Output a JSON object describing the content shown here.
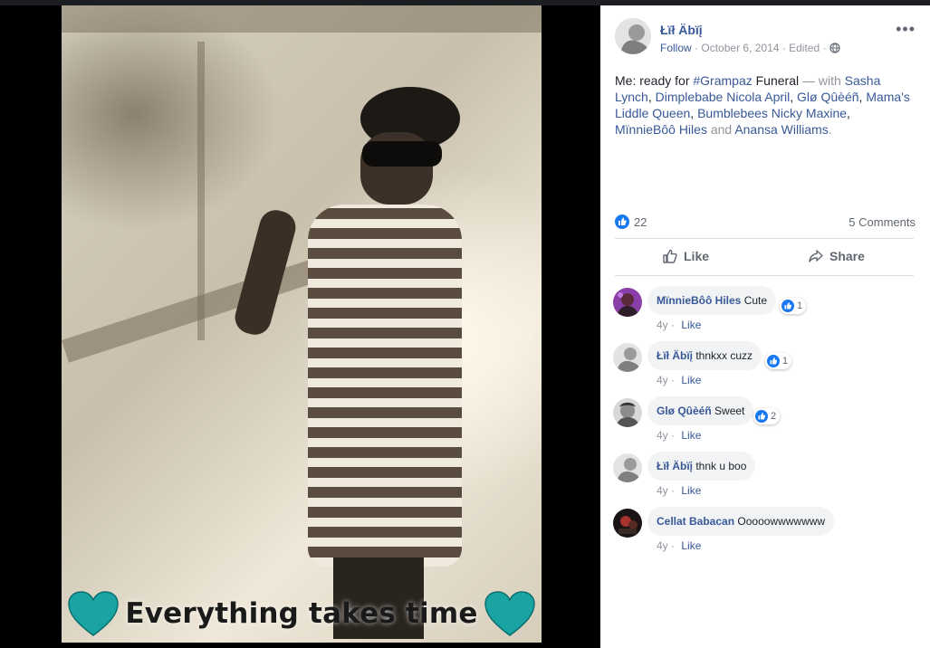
{
  "photo": {
    "caption": "Everything takes time",
    "heart_color": "#1aa3a3"
  },
  "post": {
    "author": "Łïł Äbïį",
    "follow_label": "Follow",
    "date": "October 6, 2014",
    "edited_label": "Edited",
    "more_label": "•••",
    "text": {
      "prefix": "Me: ready for ",
      "hashtag": "#Grampaz",
      "word": " Funeral",
      "with": " — with ",
      "tags": [
        "Sasha Lynch",
        "Dimplebabe Nicola April",
        "Glø Qûèéñ",
        "Mama's Liddle Queen",
        "Bumblebees Nicky Maxine",
        "MïnnieBôô Hiles"
      ],
      "and": " and ",
      "last_tag": "Anansa Williams",
      "end": "."
    },
    "reaction_count": "22",
    "comments_count": "5 Comments",
    "like_label": "Like",
    "share_label": "Share",
    "accent_color": "#385898",
    "like_color": "#1877f2"
  },
  "comments": [
    {
      "name": "MïnnieBôô Hiles",
      "text": "Cute",
      "reactions": "1",
      "age": "4y",
      "like": "Like"
    },
    {
      "name": "Łïł Äbïį",
      "text": "thnkxx cuzz",
      "reactions": "1",
      "age": "4y",
      "like": "Like"
    },
    {
      "name": "Glø Qûèéñ",
      "text": "Sweet",
      "reactions": "2",
      "age": "4y",
      "like": "Like"
    },
    {
      "name": "Łïł Äbïį",
      "text": "thnk u boo",
      "reactions": "",
      "age": "4y",
      "like": "Like"
    },
    {
      "name": "Cellat Babacan",
      "text": "Ooooowwwwwww",
      "reactions": "",
      "age": "4y",
      "like": "Like"
    }
  ]
}
